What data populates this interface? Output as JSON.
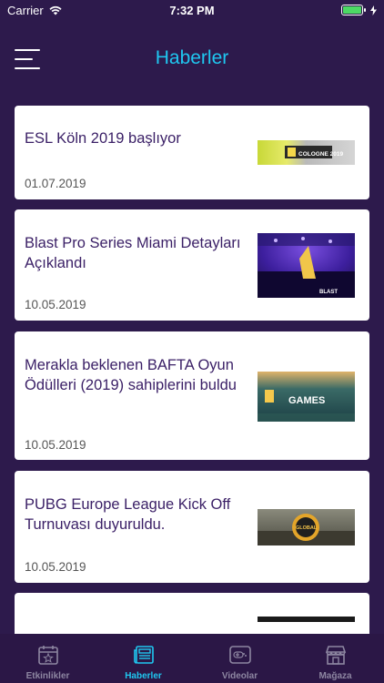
{
  "status": {
    "carrier": "Carrier",
    "time": "7:32 PM"
  },
  "header": {
    "title": "Haberler"
  },
  "news": [
    {
      "title": "ESL Köln 2019 başlıyor",
      "date": "01.07.2019",
      "image": "COLOGNE 2019"
    },
    {
      "title": "Blast Pro Series Miami Detayları Açıklandı",
      "date": "10.05.2019",
      "image": "BLAST"
    },
    {
      "title": "Merakla beklenen BAFTA Oyun Ödülleri (2019) sahiplerini buldu",
      "date": "10.05.2019",
      "image": "GAMES"
    },
    {
      "title": "PUBG Europe League Kick Off Turnuvası duyuruldu.",
      "date": "10.05.2019",
      "image": "GLOBAL"
    }
  ],
  "tabs": [
    {
      "label": "Etkinlikler",
      "icon": "calendar-star-icon",
      "active": false
    },
    {
      "label": "Haberler",
      "icon": "newspaper-icon",
      "active": true
    },
    {
      "label": "Videolar",
      "icon": "gamepad-icon",
      "active": false
    },
    {
      "label": "Mağaza",
      "icon": "store-icon",
      "active": false
    }
  ],
  "colors": {
    "background": "#2d1a4c",
    "accent": "#1fc7f0",
    "title_text": "#3a1f66"
  }
}
